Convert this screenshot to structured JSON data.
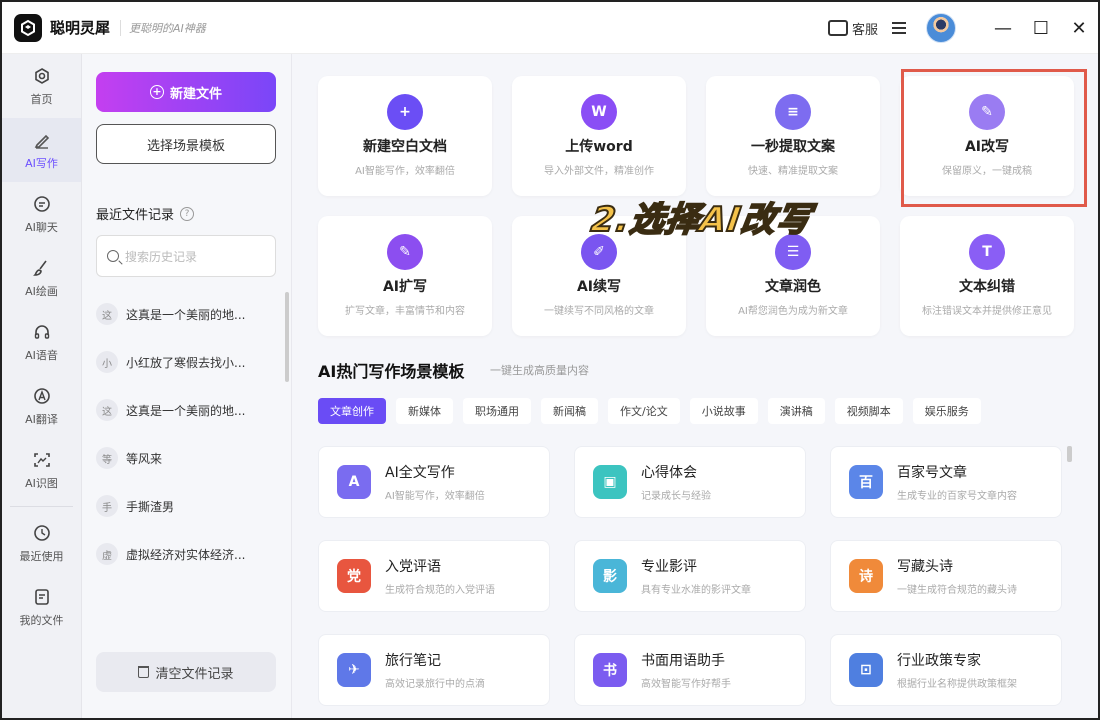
{
  "app": {
    "name": "聪明灵犀",
    "slogan": "更聪明的AI神器",
    "kefu_label": "客服"
  },
  "rail": [
    {
      "label": "首页",
      "icon": "home-icon"
    },
    {
      "label": "AI写作",
      "icon": "pen-icon",
      "active": true
    },
    {
      "label": "AI聊天",
      "icon": "chat-icon"
    },
    {
      "label": "AI绘画",
      "icon": "brush-icon"
    },
    {
      "label": "AI语音",
      "icon": "headphone-icon"
    },
    {
      "label": "AI翻译",
      "icon": "translate-icon"
    },
    {
      "label": "AI识图",
      "icon": "scan-image-icon"
    },
    {
      "label": "最近使用",
      "icon": "clock-icon"
    },
    {
      "label": "我的文件",
      "icon": "file-icon"
    }
  ],
  "panel": {
    "new_file": "新建文件",
    "choose_template": "选择场景模板",
    "recent_title": "最近文件记录",
    "search_placeholder": "搜索历史记录",
    "recent": [
      {
        "badge": "这",
        "title": "这真是一个美丽的地..."
      },
      {
        "badge": "小",
        "title": "小红放了寒假去找小..."
      },
      {
        "badge": "这",
        "title": "这真是一个美丽的地..."
      },
      {
        "badge": "等",
        "title": "等风来"
      },
      {
        "badge": "手",
        "title": "手撕渣男"
      },
      {
        "badge": "虚",
        "title": "虚拟经济对实体经济..."
      }
    ],
    "clear": "清空文件记录"
  },
  "cards": [
    {
      "title": "新建空白文档",
      "desc": "AI智能写作，效率翻倍",
      "icon": "plus-icon",
      "color": "#6b4ef5",
      "glyph": "+"
    },
    {
      "title": "上传word",
      "desc": "导入外部文件，精准创作",
      "icon": "word-icon",
      "color": "#8a4ef5",
      "glyph": "W"
    },
    {
      "title": "一秒提取文案",
      "desc": "快速、精准提取文案",
      "icon": "extract-icon",
      "color": "#7d6cf0",
      "glyph": "≡"
    },
    {
      "title": "AI改写",
      "desc": "保留原义，一键成稿",
      "icon": "feather-icon",
      "color": "#9a7cf2",
      "glyph": "✎"
    },
    {
      "title": "AI扩写",
      "desc": "扩写文章，丰富情节和内容",
      "icon": "expand-pen-icon",
      "color": "#8c4ef0",
      "glyph": "✎"
    },
    {
      "title": "AI续写",
      "desc": "一键续写不同风格的文章",
      "icon": "continue-icon",
      "color": "#7a55f0",
      "glyph": "✐"
    },
    {
      "title": "文章润色",
      "desc": "AI帮您润色为成为新文章",
      "icon": "polish-icon",
      "color": "#7f5df2",
      "glyph": "☰"
    },
    {
      "title": "文本纠错",
      "desc": "标注错误文本并提供修正意见",
      "icon": "correct-icon",
      "color": "#8a5ef5",
      "glyph": "T"
    }
  ],
  "annotation": "2.选择AI改写",
  "section": {
    "title": "AI热门写作场景模板",
    "subtitle": "一键生成高质量内容"
  },
  "tabs": [
    "文章创作",
    "新媒体",
    "职场通用",
    "新闻稿",
    "作文/论文",
    "小说故事",
    "演讲稿",
    "视频脚本",
    "娱乐服务"
  ],
  "templates": [
    {
      "title": "AI全文写作",
      "desc": "AI智能写作，效率翻倍",
      "icon": "ai-write-icon",
      "color": "#7a6cf0",
      "glyph": "A"
    },
    {
      "title": "心得体会",
      "desc": "记录成长与经验",
      "icon": "notebook-icon",
      "color": "#3cc4c0",
      "glyph": "▣"
    },
    {
      "title": "百家号文章",
      "desc": "生成专业的百家号文章内容",
      "icon": "baijiahao-icon",
      "color": "#5b86e8",
      "glyph": "百"
    },
    {
      "title": "入党评语",
      "desc": "生成符合规范的入党评语",
      "icon": "party-icon",
      "color": "#e8563f",
      "glyph": "党"
    },
    {
      "title": "专业影评",
      "desc": "具有专业水准的影评文章",
      "icon": "film-icon",
      "color": "#4ab6d8",
      "glyph": "影"
    },
    {
      "title": "写藏头诗",
      "desc": "一键生成符合规范的藏头诗",
      "icon": "poem-icon",
      "color": "#f08a3a",
      "glyph": "诗"
    },
    {
      "title": "旅行笔记",
      "desc": "高效记录旅行中的点滴",
      "icon": "travel-icon",
      "color": "#5f78e8",
      "glyph": "✈"
    },
    {
      "title": "书面用语助手",
      "desc": "高效智能写作好帮手",
      "icon": "book-icon",
      "color": "#7b5cf0",
      "glyph": "书"
    },
    {
      "title": "行业政策专家",
      "desc": "根据行业名称提供政策框架",
      "icon": "policy-icon",
      "color": "#4f7fe0",
      "glyph": "⊡"
    }
  ]
}
